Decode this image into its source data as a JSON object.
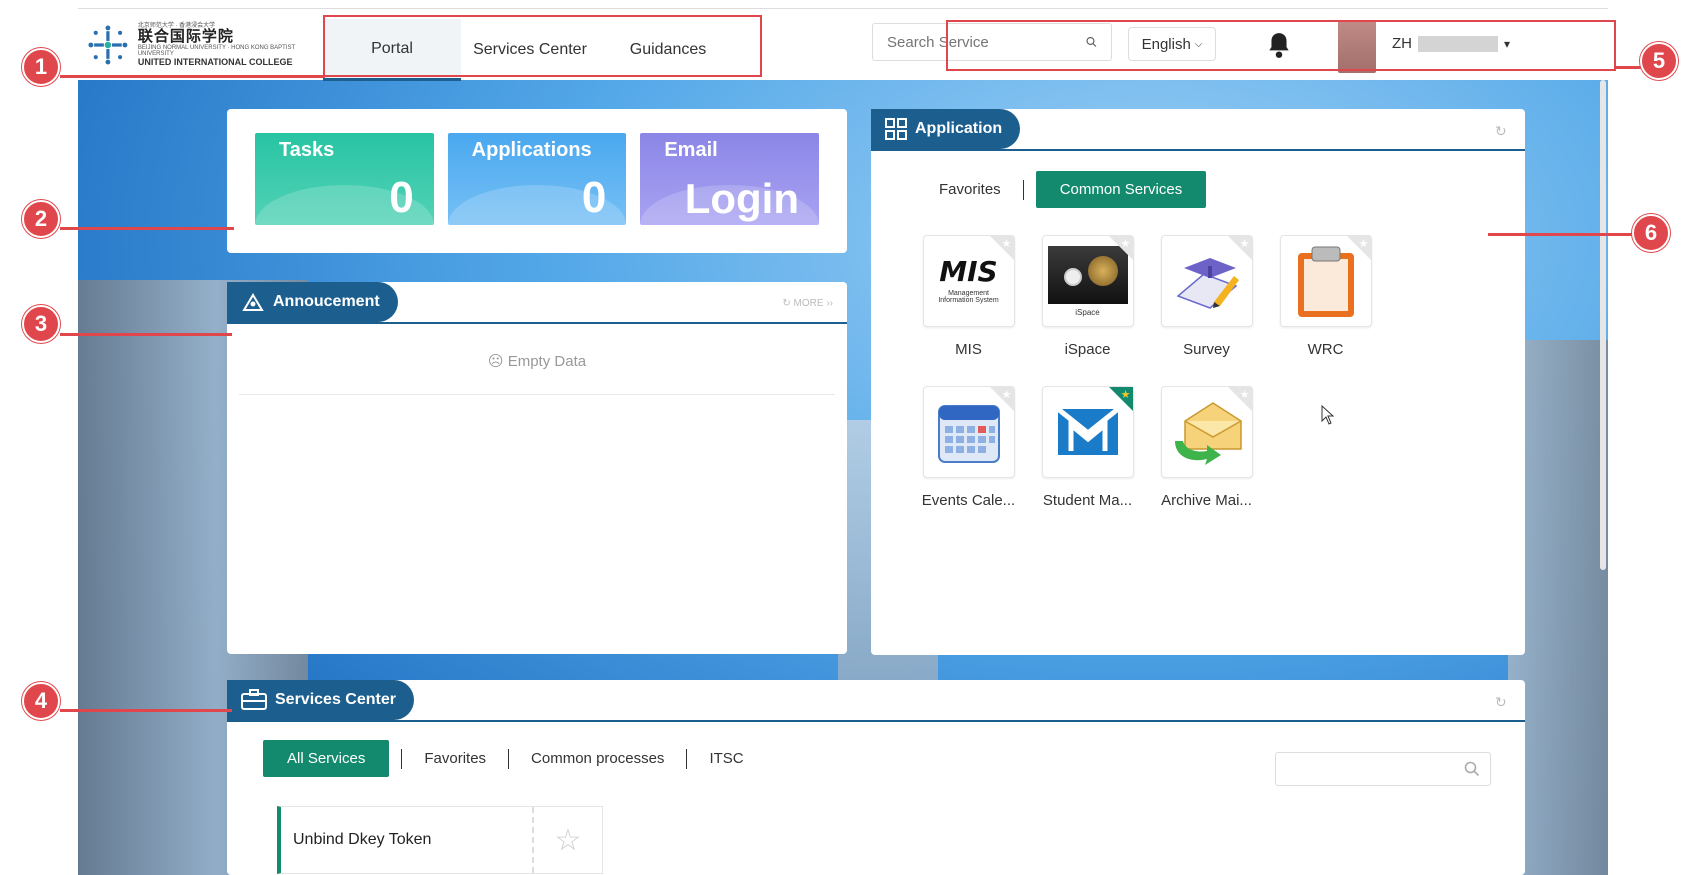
{
  "header": {
    "logo": {
      "cn": "联合国际学院",
      "small_cn": "北京师范大学 · 香港浸会大学",
      "small_en": "BEIJING NORMAL UNIVERSITY · HONG KONG BAPTIST UNIVERSITY",
      "en": "UNITED INTERNATIONAL COLLEGE"
    },
    "nav": [
      {
        "label": "Portal",
        "active": true
      },
      {
        "label": "Services Center",
        "active": false
      },
      {
        "label": "Guidances",
        "active": false
      }
    ],
    "search_placeholder": "Search Service",
    "language": "English",
    "username": "ZH"
  },
  "stats": [
    {
      "title": "Tasks",
      "value": "0"
    },
    {
      "title": "Applications",
      "value": "0"
    },
    {
      "title": "Email",
      "value": "Login"
    }
  ],
  "announcement": {
    "title": "Annoucement",
    "more": "MORE",
    "empty": "Empty Data"
  },
  "application": {
    "title": "Application",
    "tabs": [
      {
        "label": "Favorites",
        "active": false
      },
      {
        "label": "Common Services",
        "active": true
      }
    ],
    "apps": [
      {
        "label": "MIS",
        "icon": "mis-icon"
      },
      {
        "label": "iSpace",
        "icon": "ispace-icon"
      },
      {
        "label": "Survey",
        "icon": "survey-icon"
      },
      {
        "label": "WRC",
        "icon": "clipboard-icon"
      },
      {
        "label": "Events Cale...",
        "icon": "calendar-icon"
      },
      {
        "label": "Student Ma...",
        "icon": "mail-m-icon"
      },
      {
        "label": "Archive Mai...",
        "icon": "archive-mail-icon"
      }
    ],
    "mis_subtitle": "Management Information System",
    "ispace_subtitle": "iSpace"
  },
  "services": {
    "title": "Services Center",
    "tabs": [
      {
        "label": "All Services",
        "active": true
      },
      {
        "label": "Favorites",
        "active": false
      },
      {
        "label": "Common processes",
        "active": false
      },
      {
        "label": "ITSC",
        "active": false
      }
    ],
    "items": [
      {
        "name": "Unbind Dkey Token"
      }
    ]
  },
  "annotations": [
    "1",
    "2",
    "3",
    "4",
    "5",
    "6"
  ],
  "colors": {
    "primary": "#1c5f8e",
    "green": "#138a6e",
    "annotation": "#e0474c"
  }
}
